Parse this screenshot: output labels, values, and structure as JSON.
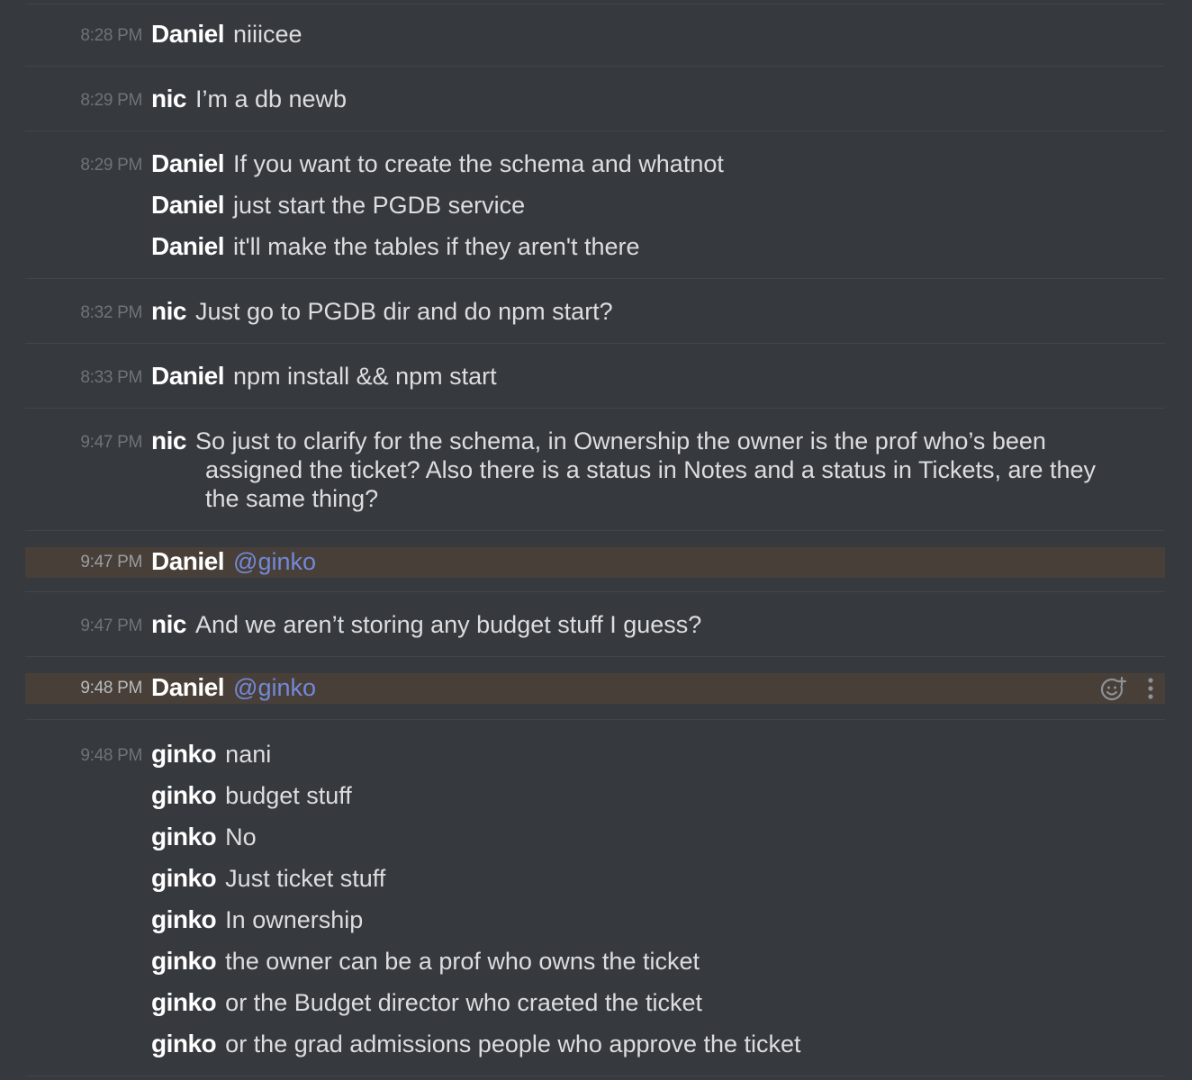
{
  "messages": [
    {
      "timestamp": "8:28 PM",
      "lines": [
        {
          "user": "Daniel",
          "text": "niiicee"
        }
      ]
    },
    {
      "timestamp": "8:29 PM",
      "lines": [
        {
          "user": "nic",
          "text": "I’m a db newb"
        }
      ]
    },
    {
      "timestamp": "8:29 PM",
      "lines": [
        {
          "user": "Daniel",
          "text": "If you want to create the schema and whatnot"
        },
        {
          "user": "Daniel",
          "text": "just start the PGDB service"
        },
        {
          "user": "Daniel",
          "text": "it'll make the tables if they aren't there"
        }
      ]
    },
    {
      "timestamp": "8:32 PM",
      "lines": [
        {
          "user": "nic",
          "text": "Just go to PGDB dir and do npm start?"
        }
      ]
    },
    {
      "timestamp": "8:33 PM",
      "lines": [
        {
          "user": "Daniel",
          "text": "npm install && npm start"
        }
      ]
    },
    {
      "timestamp": "9:47 PM",
      "lines": [
        {
          "user": "nic",
          "text_first": "So just to clarify for the schema, in Ownership the owner is the prof who’s been",
          "text_rest": "assigned the ticket? Also there is a status in Notes and a status in Tickets, are they the same thing?"
        }
      ]
    },
    {
      "timestamp": "9:47 PM",
      "highlighted": true,
      "lines": [
        {
          "user": "Daniel",
          "mention": "@ginko"
        }
      ]
    },
    {
      "timestamp": "9:47 PM",
      "lines": [
        {
          "user": "nic",
          "text": "And we aren’t storing any budget stuff I guess?"
        }
      ]
    },
    {
      "timestamp": "9:48 PM",
      "highlighted": true,
      "hover": true,
      "lines": [
        {
          "user": "Daniel",
          "mention": "@ginko"
        }
      ]
    },
    {
      "timestamp": "9:48 PM",
      "lines": [
        {
          "user": "ginko",
          "text": "nani"
        },
        {
          "user": "ginko",
          "text": "budget stuff"
        },
        {
          "user": "ginko",
          "text": "No"
        },
        {
          "user": "ginko",
          "text": "Just ticket stuff"
        },
        {
          "user": "ginko",
          "text": "In ownership"
        },
        {
          "user": "ginko",
          "text": "the owner can be a prof who owns the ticket"
        },
        {
          "user": "ginko",
          "text": "or the Budget director who craeted the ticket"
        },
        {
          "user": "ginko",
          "text": "or the grad admissions people who approve the ticket"
        }
      ]
    }
  ],
  "icons": {
    "add_reaction": "emoji-add-icon",
    "more": "more-vertical-icon"
  },
  "colors": {
    "background": "#36393e",
    "mention": "#7289da",
    "highlight": "#483f38",
    "username": "#ffffff",
    "timestamp": "#6f7378"
  }
}
